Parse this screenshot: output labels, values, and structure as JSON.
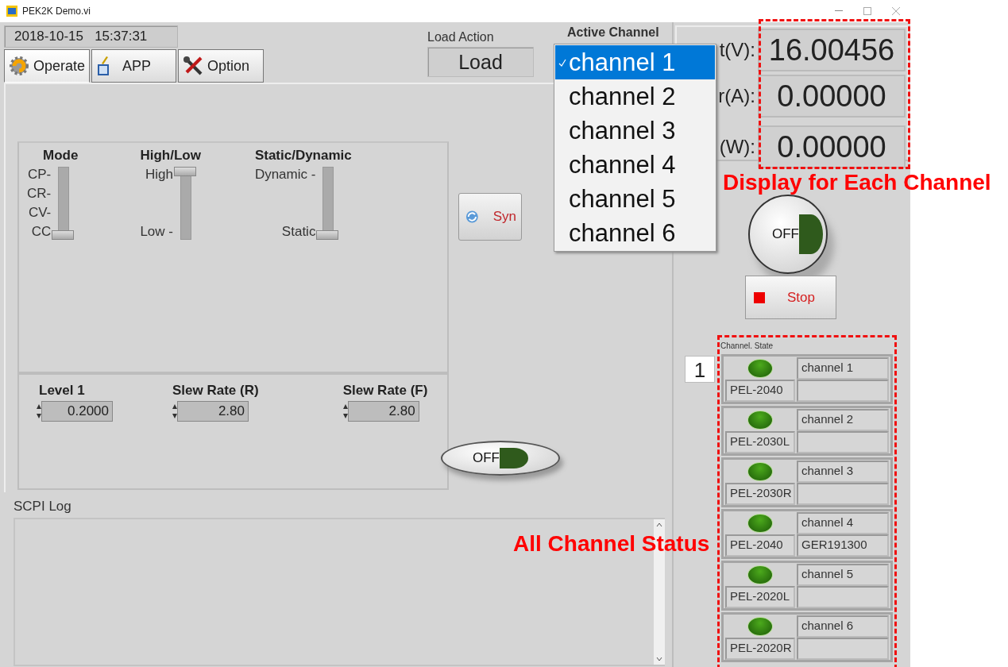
{
  "window": {
    "title": "PEK2K Demo.vi"
  },
  "datetime": "2018-10-15   15:37:31",
  "tabs": [
    {
      "label": "Operate",
      "selected": true
    },
    {
      "label": "APP",
      "selected": false
    },
    {
      "label": "Option",
      "selected": false
    }
  ],
  "load_action": {
    "label": "Load Action",
    "value": "Load"
  },
  "active_channel": {
    "label": "Active Channel",
    "options": [
      {
        "label": "channel 1",
        "selected": true
      },
      {
        "label": "channel 2",
        "selected": false
      },
      {
        "label": "channel 3",
        "selected": false
      },
      {
        "label": "channel 4",
        "selected": false
      },
      {
        "label": "channel 5",
        "selected": false
      },
      {
        "label": "channel 6",
        "selected": false
      }
    ]
  },
  "sliders": [
    {
      "title": "Mode",
      "top": "CP-",
      "middle": [
        "CR-",
        "CV-"
      ],
      "bottom": "CC",
      "level": 0
    },
    {
      "title": "High/Low",
      "top": "High",
      "bottom": "Low -",
      "level": 1
    },
    {
      "title": "Static/Dynamic",
      "top": "Dynamic -",
      "bottom": "Static",
      "level": 0
    }
  ],
  "numerics": [
    {
      "label": "Level 1",
      "value": "0.2000"
    },
    {
      "label": "Slew Rate (R)",
      "value": "2.80"
    },
    {
      "label": "Slew Rate (F)",
      "value": "2.80"
    }
  ],
  "sync_button": {
    "label": "Syn"
  },
  "load_switch": {
    "label": "OFF",
    "on": false
  },
  "scpi_log": {
    "label": "SCPI Log"
  },
  "readouts": [
    {
      "label": "t(V):",
      "value": "16.00456"
    },
    {
      "label": "r(A):",
      "value": "0.00000"
    },
    {
      "label": "(W):",
      "value": "0.00000"
    }
  ],
  "output_button": {
    "label": "OFF",
    "on": false
  },
  "stop_button": {
    "label": "Stop"
  },
  "channel_state": {
    "label": "Channel. State",
    "index": "1",
    "channels": [
      {
        "name": "channel 1",
        "model": "PEL-2040",
        "on": true
      },
      {
        "name": "channel 2",
        "model": "PEL-2030L",
        "on": true
      },
      {
        "name": "channel 3",
        "model": "PEL-2030R",
        "on": true
      },
      {
        "name": "channel 4",
        "model": "PEL-2040",
        "serial": "GER191300",
        "on": true
      },
      {
        "name": "channel 5",
        "model": "PEL-2020L",
        "on": true
      },
      {
        "name": "channel 6",
        "model": "PEL-2020R",
        "on": true
      }
    ]
  },
  "annotations": [
    {
      "text": "Display for Each Channel"
    },
    {
      "text": "All Channel Status"
    }
  ]
}
